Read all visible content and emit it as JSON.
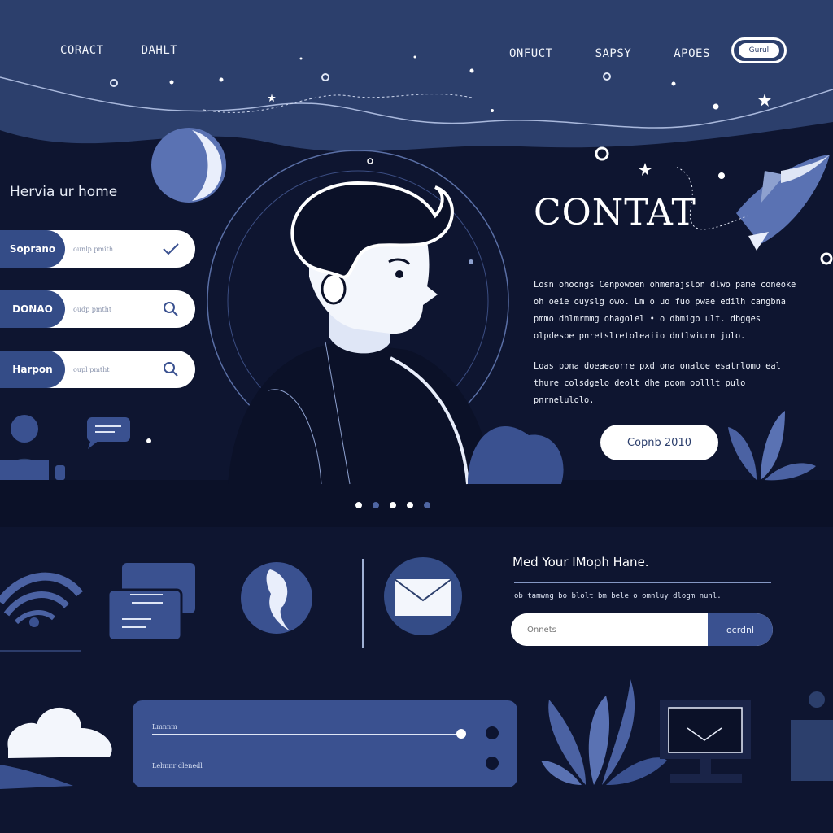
{
  "header": {
    "nav_left": [
      "CORACT",
      "DAHLT"
    ],
    "nav_right": [
      "ONFUCT",
      "SAPSY",
      "APOES"
    ],
    "pill_label": "Gurul"
  },
  "hero": {
    "left_title": "Hervia ur home",
    "inputs": [
      {
        "tag": "Soprano",
        "text": "ounlp pmith",
        "icon": "check-icon"
      },
      {
        "tag": "DONAO",
        "text": "oudp pmtht",
        "icon": "search-icon"
      },
      {
        "tag": "Harpon",
        "text": "oupl pmtht",
        "icon": "search-icon"
      }
    ],
    "title": "CONTAT",
    "body": [
      "Losn ohoongs Cenpowoen ohmenajslon dlwo pame coneoke oh oeie ouyslg owo. Lm o uo fuo pwae edilh cangbna pmmo dhlmrmmg ohagolel • o dbmigo ult. dbgqes olpdesoe pnretslretoleaiio dntlwiunn julo.",
      "Loas pona doeaeaorre pxd ona onaloe esatrlomo eal thure colsdgelo deolt dhe poom oolllt pulo pnrnelulolo."
    ],
    "cta_label": "Copnb 2010"
  },
  "carousel": {
    "dots": 5,
    "active": [
      0,
      2,
      3
    ]
  },
  "newsletter": {
    "title": "Med Your IMoph Hane.",
    "subtitle": "ob tamwng bo blolt bm bele o omnluy dlogm nunl.",
    "placeholder": "Onnets",
    "button_label": "ocrdnl"
  },
  "slider_card": {
    "label_top": "Lmnnm",
    "label_bottom": "Lehnnr dlenedl",
    "value": 0.96
  },
  "colors": {
    "top_band": "#2c3f6c",
    "background": "#0e1530",
    "accent": "#3a5190",
    "white": "#ffffff"
  }
}
